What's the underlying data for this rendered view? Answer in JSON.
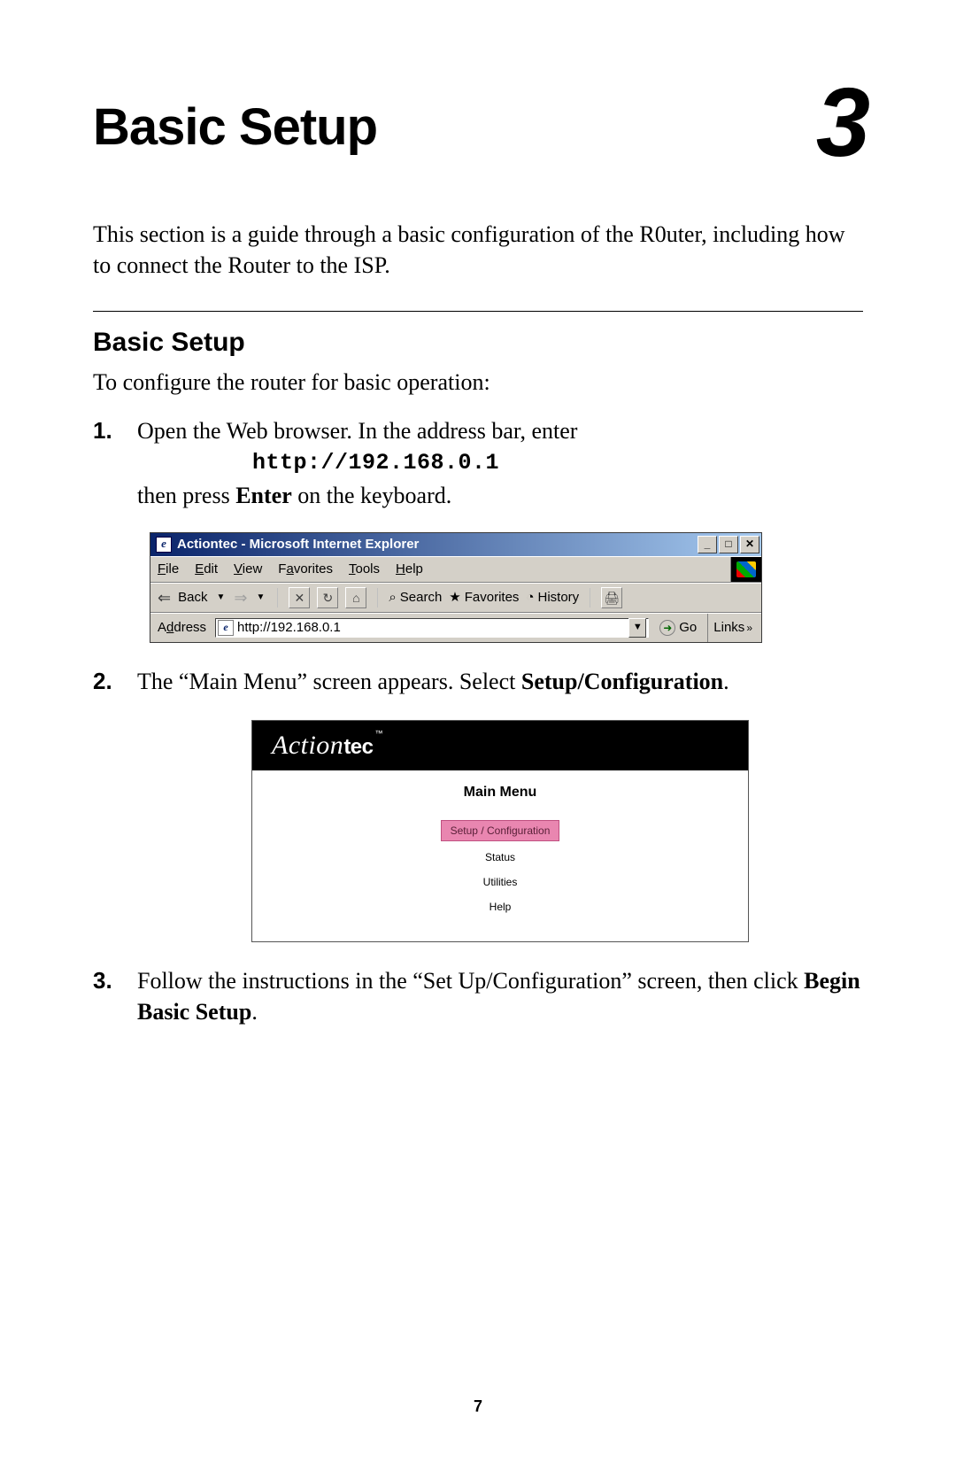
{
  "chapter": {
    "title": "Basic Setup",
    "number": "3"
  },
  "intro": "This section is a guide through a basic configuration of the R0uter, including how to connect the Router to the ISP.",
  "section_title": "Basic Setup",
  "section_lead": "To configure the router for basic operation:",
  "steps": {
    "s1": {
      "part1": "Open the Web browser. In the address bar, enter",
      "url": "http://192.168.0.1",
      "part2_a": "then press ",
      "part2_b": "Enter",
      "part2_c": " on the keyboard."
    },
    "s2": {
      "part_a": "The “Main Menu” screen appears. Select ",
      "part_b": "Setup/Configuration",
      "part_c": "."
    },
    "s3": {
      "part_a": "Follow the instructions in the “Set Up/Configuration” screen, then click ",
      "part_b": "Begin Basic Setup",
      "part_c": "."
    }
  },
  "ie": {
    "title": "Actiontec - Microsoft Internet Explorer",
    "win_min": "_",
    "win_max": "□",
    "win_close": "✕",
    "menu": {
      "file": "File",
      "edit": "Edit",
      "view": "View",
      "favorites": "Favorites",
      "tools": "Tools",
      "help": "Help"
    },
    "toolbar": {
      "back": "Back",
      "stop_glyph": "✕",
      "refresh_glyph": "↻",
      "home_glyph": "⌂",
      "search": "Search",
      "search_glyph": "⌕",
      "favorites": "Favorites",
      "fav_glyph": "★",
      "history": "History",
      "history_glyph": "◔",
      "print_glyph": "🖨"
    },
    "addressbar": {
      "label": "Address",
      "value": "http://192.168.0.1",
      "go": "Go",
      "links": "Links",
      "chevron": "»"
    }
  },
  "actiontec": {
    "logo_script": "Action",
    "logo_tec": "tec",
    "logo_tm": "™",
    "menu_title": "Main Menu",
    "items": {
      "setup": "Setup / Configuration",
      "status": "Status",
      "utilities": "Utilities",
      "help": "Help"
    }
  },
  "page_number": "7"
}
